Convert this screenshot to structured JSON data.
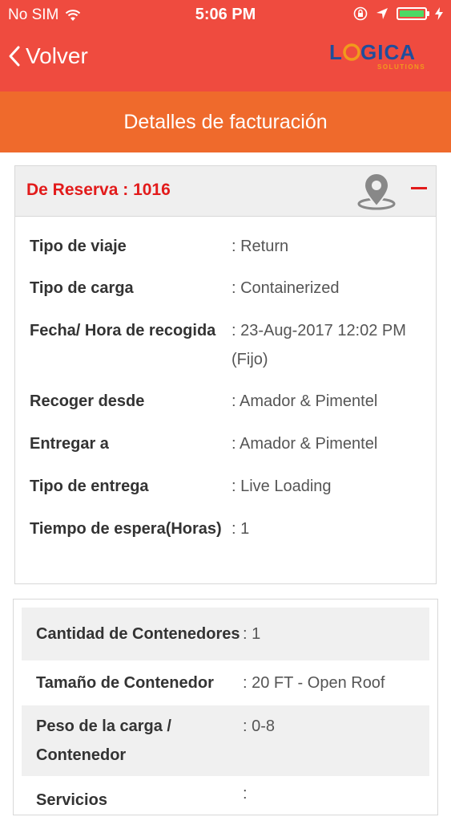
{
  "status_bar": {
    "carrier": "No SIM",
    "time": "5:06 PM"
  },
  "nav": {
    "back_label": "Volver",
    "logo_text_main": "LOGICA",
    "logo_text_sub": "SOLUTIONS"
  },
  "page": {
    "title": "Detalles de facturación"
  },
  "reservation": {
    "header": "De Reserva : 1016",
    "rows": [
      {
        "label": "Tipo de viaje",
        "value": ": Return"
      },
      {
        "label": "Tipo de carga",
        "value": ": Containerized"
      },
      {
        "label": "Fecha/ Hora de recogida",
        "value": ": 23-Aug-2017 12:02 PM (Fijo)"
      },
      {
        "label": "Recoger desde",
        "value": ": Amador & Pimentel"
      },
      {
        "label": "Entregar a",
        "value": ": Amador & Pimentel"
      },
      {
        "label": "Tipo de entrega",
        "value": ": Live Loading"
      },
      {
        "label": "Tiempo de espera(Horas)",
        "value": ": 1"
      }
    ]
  },
  "container": {
    "rows": [
      {
        "label": "Cantidad de Contenedores",
        "value": ": 1"
      },
      {
        "label": "Tamaño de Contenedor",
        "value": ": 20 FT - Open Roof"
      },
      {
        "label": "Peso de la carga / Contenedor",
        "value": ": 0-8"
      },
      {
        "label": "Servicios",
        "value": ":"
      }
    ]
  },
  "colors": {
    "header_red": "#ef4b3f",
    "title_orange": "#ef6a2c",
    "reserva_red": "#e21b1b",
    "logo_blue": "#1f4e9c",
    "logo_orange": "#f19a1c",
    "battery_green": "#4cd964"
  },
  "icons": [
    "wifi-icon",
    "lock-rotation-icon",
    "location-arrow-icon",
    "battery-icon",
    "charging-bolt-icon",
    "chevron-left-icon",
    "map-pin-icon",
    "minus-icon"
  ]
}
